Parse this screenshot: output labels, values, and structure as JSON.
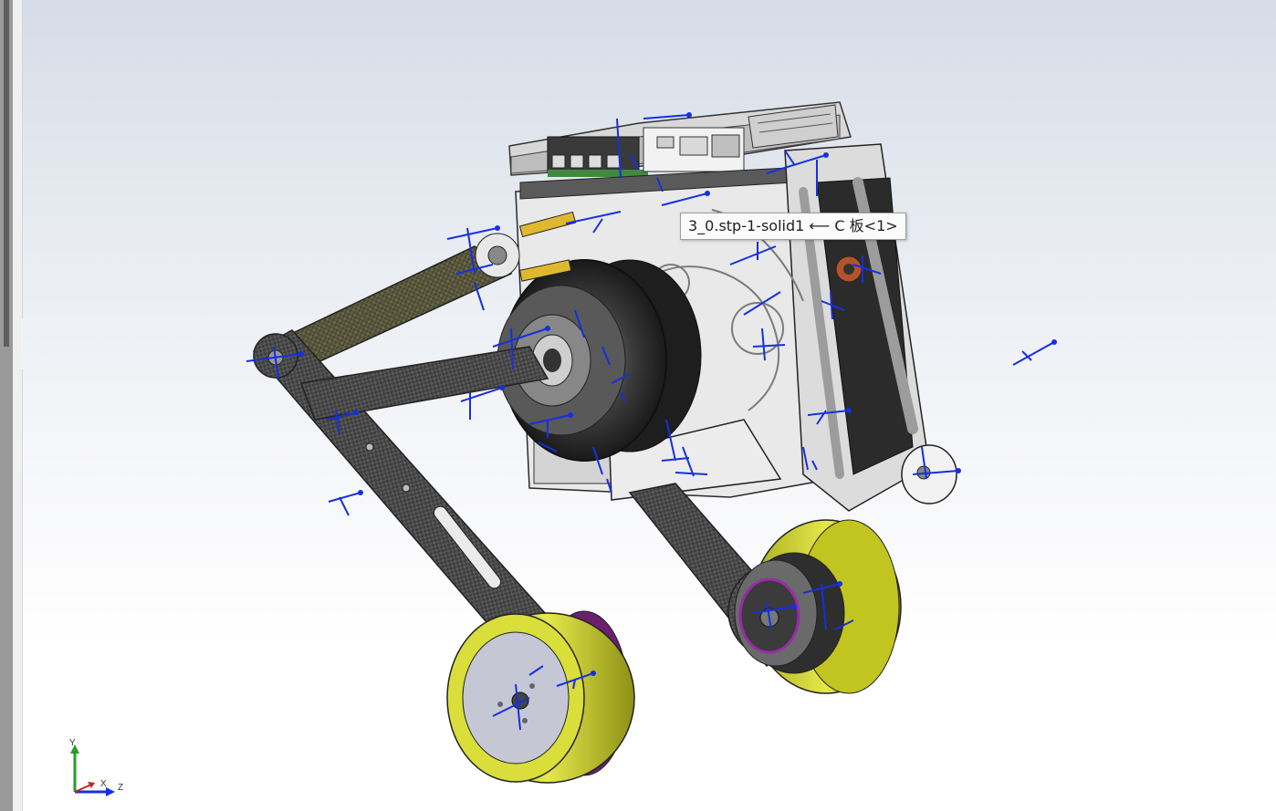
{
  "viewport": {
    "tooltip_text": "3_0.stp-1-solid1 ⟵ C 板<1>"
  },
  "triad": {
    "y_label": "Y",
    "x_label": "X",
    "z_label": "Z"
  },
  "colors": {
    "carbon_fiber": "#4a4a4a",
    "wheel_tire": "#d9de3a",
    "hub_plate": "#b9bcc8",
    "bracket_plate": "#e6e6e6",
    "reference_axes": "#1530e0",
    "motor_body": "#2c2c2c",
    "magenta_ring": "#9a2aa8"
  }
}
